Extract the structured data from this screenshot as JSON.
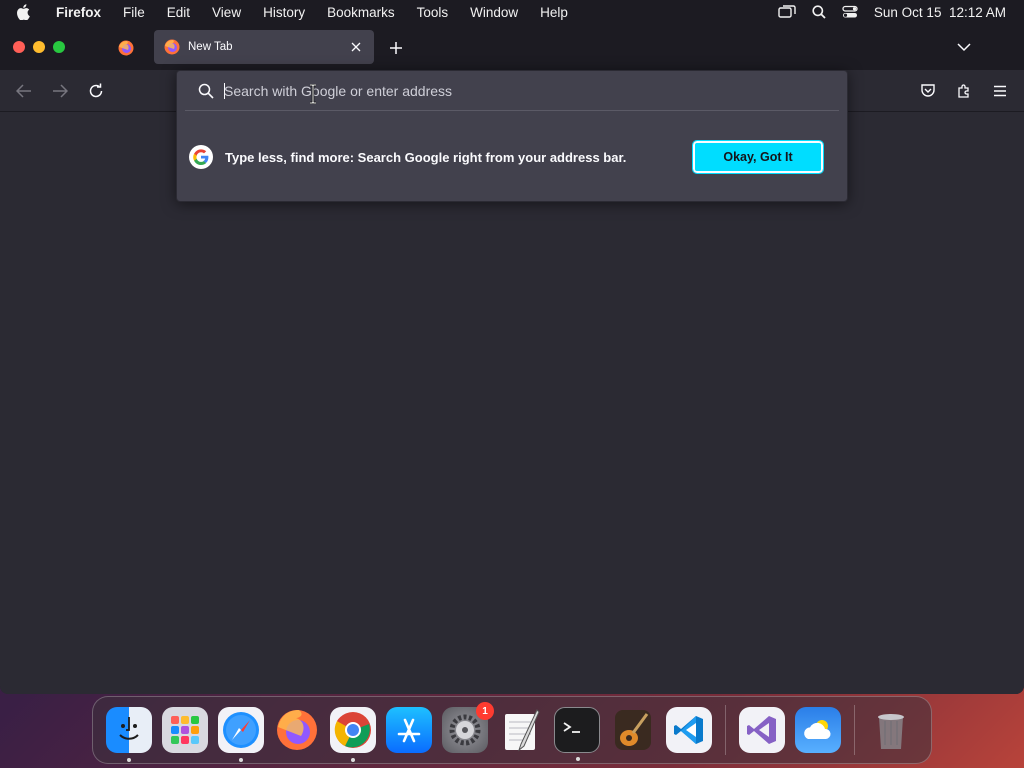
{
  "menubar": {
    "app_name": "Firefox",
    "items": [
      "File",
      "Edit",
      "View",
      "History",
      "Bookmarks",
      "Tools",
      "Window",
      "Help"
    ],
    "clock": "Sun Oct 15  12:12 AM"
  },
  "tabs": {
    "active_title": "New Tab"
  },
  "urlbar": {
    "placeholder": "Search with Google or enter address",
    "value": ""
  },
  "tip": {
    "text": "Type less, find more: Search Google right from your address bar.",
    "button_label": "Okay, Got It"
  },
  "dock": {
    "apps": [
      "Finder",
      "Launchpad",
      "Safari",
      "Firefox",
      "Chrome",
      "App Store",
      "System Settings",
      "TextEdit",
      "Terminal",
      "GarageBand",
      "Visual Studio Code",
      "Visual Studio",
      "Weather",
      "Trash"
    ],
    "settings_badge": "1"
  },
  "colors": {
    "accent": "#00ddff",
    "window_bg": "#2b2a33",
    "toolbar_bg": "#1c1b22",
    "panel_bg": "#42414d"
  }
}
